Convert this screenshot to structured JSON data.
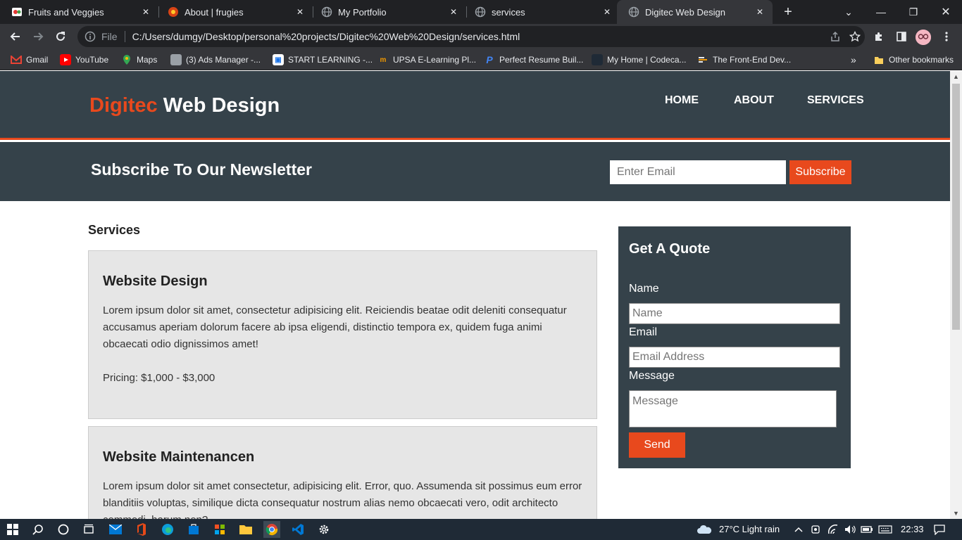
{
  "browser": {
    "tabs": [
      {
        "title": "Fruits and Veggies",
        "icon": "fruit-favicon",
        "active": false
      },
      {
        "title": "About | frugies",
        "icon": "frugies-favicon",
        "active": false
      },
      {
        "title": "My Portfolio",
        "icon": "globe-icon",
        "active": false
      },
      {
        "title": "services",
        "icon": "globe-icon",
        "active": false
      },
      {
        "title": "Digitec Web Design",
        "icon": "globe-icon",
        "active": true
      }
    ],
    "protocol_label": "File",
    "url": "C:/Users/dumgy/Desktop/personal%20projects/Digitec%20Web%20Design/services.html",
    "bookmarks": [
      {
        "label": "Gmail",
        "icon": "gmail-icon",
        "color": "#ea4335"
      },
      {
        "label": "YouTube",
        "icon": "youtube-icon",
        "color": "#ff0000"
      },
      {
        "label": "Maps",
        "icon": "maps-icon",
        "color": "#34a853"
      },
      {
        "label": "(3) Ads Manager -...",
        "icon": "ads-manager-icon",
        "color": "#9aa0a6"
      },
      {
        "label": "START LEARNING -...",
        "icon": "start-learning-icon",
        "color": "#1a73e8"
      },
      {
        "label": "UPSA E-Learning Pl...",
        "icon": "upsa-icon",
        "color": "#f29900"
      },
      {
        "label": "Perfect Resume Buil...",
        "icon": "resume-icon",
        "color": "#4285f4"
      },
      {
        "label": "My Home | Codeca...",
        "icon": "codecademy-icon",
        "color": "#1f2a36"
      },
      {
        "label": "The Front-End Dev...",
        "icon": "frontend-icon",
        "color": "#e8eaed"
      }
    ],
    "bookmarks_overflow": "»",
    "other_bookmarks": "Other bookmarks"
  },
  "site": {
    "logo_highlight": "Digitec",
    "logo_rest": " Web Design",
    "nav": [
      "HOME",
      "ABOUT",
      "SERVICES"
    ],
    "newsletter": {
      "title": "Subscribe To Our Newsletter",
      "email_placeholder": "Enter Email",
      "button": "Subscribe"
    },
    "services_heading": "Services",
    "services": [
      {
        "title": "Website Design",
        "description": "Lorem ipsum dolor sit amet, consectetur adipisicing elit. Reiciendis beatae odit deleniti consequatur accusamus aperiam dolorum facere ab ipsa eligendi, distinctio tempora ex, quidem fuga animi obcaecati odio dignissimos amet!",
        "pricing": "Pricing: $1,000 - $3,000"
      },
      {
        "title": "Website Maintenancen",
        "description": "Lorem ipsum dolor sit amet consectetur, adipisicing elit. Error, quo. Assumenda sit possimus eum error blanditiis voluptas, similique dicta consequatur nostrum alias nemo obcaecati vero, odit architecto commodi, harum non?"
      }
    ],
    "quote": {
      "title": "Get A Quote",
      "name_label": "Name",
      "name_placeholder": "Name",
      "email_label": "Email",
      "email_placeholder": "Email Address",
      "message_label": "Message",
      "message_placeholder": "Message",
      "send_button": "Send"
    },
    "colors": {
      "accent": "#e8491d",
      "dark": "#35424a",
      "card": "#e6e6e6"
    }
  },
  "taskbar": {
    "weather": "27°C  Light rain",
    "time": "22:33"
  }
}
